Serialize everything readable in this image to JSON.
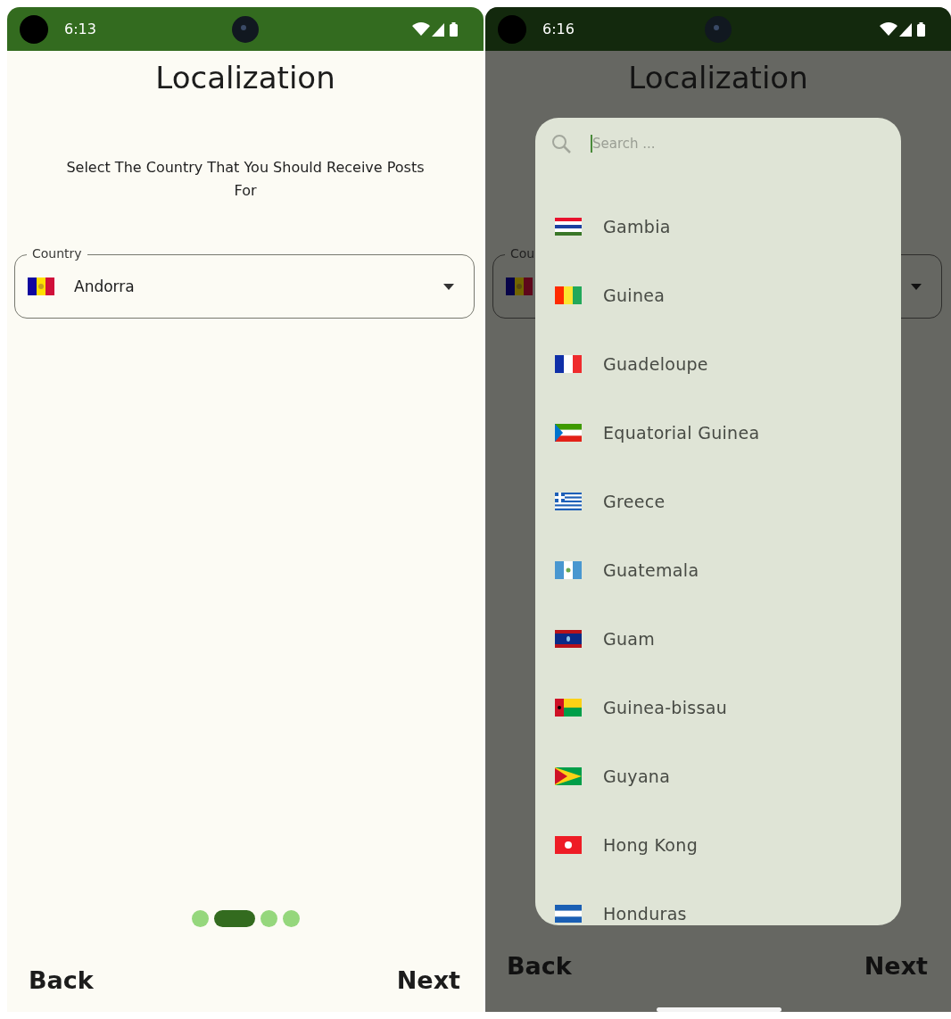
{
  "screens": [
    {
      "status_bar": {
        "time": "6:13"
      },
      "title": "Localization",
      "subtitle": "Select The Country That You Should Receive Posts For",
      "country_field": {
        "label": "Country",
        "value": "Andorra"
      },
      "pager": [
        {
          "selected": false
        },
        {
          "selected": true
        },
        {
          "selected": false
        },
        {
          "selected": false
        }
      ],
      "buttons": [
        "Back",
        "Next"
      ]
    },
    {
      "status_bar": {
        "time": "6:16"
      },
      "title": "Localization",
      "country_field": {
        "label": "Cou"
      },
      "dialog": {
        "search": {
          "placeholder": "Search ..."
        },
        "countries": [
          {
            "name": "Gambia"
          },
          {
            "name": "Guinea"
          },
          {
            "name": "Guadeloupe"
          },
          {
            "name": "Equatorial Guinea"
          },
          {
            "name": "Greece"
          },
          {
            "name": "Guatemala"
          },
          {
            "name": "Guam"
          },
          {
            "name": "Guinea-bissau"
          },
          {
            "name": "Guyana"
          },
          {
            "name": "Hong Kong"
          },
          {
            "name": "Honduras"
          }
        ]
      },
      "buttons": [
        "Back",
        "Next"
      ]
    }
  ]
}
